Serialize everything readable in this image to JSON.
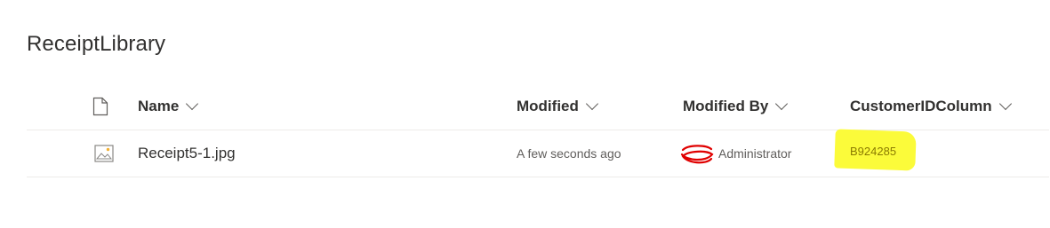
{
  "library": {
    "title": "ReceiptLibrary"
  },
  "columns": {
    "type_icon": "document-icon",
    "name": "Name",
    "modified": "Modified",
    "modified_by": "Modified By",
    "customer_id": "CustomerIDColumn"
  },
  "rows": [
    {
      "file_icon": "image-file-icon",
      "name": "Receipt5-1.jpg",
      "modified": "A few seconds ago",
      "modified_by": "Administrator",
      "customer_id": "B924285"
    }
  ],
  "colors": {
    "highlight": "#fbfb3a",
    "redaction": "#e00000",
    "divider": "#edebe9"
  }
}
